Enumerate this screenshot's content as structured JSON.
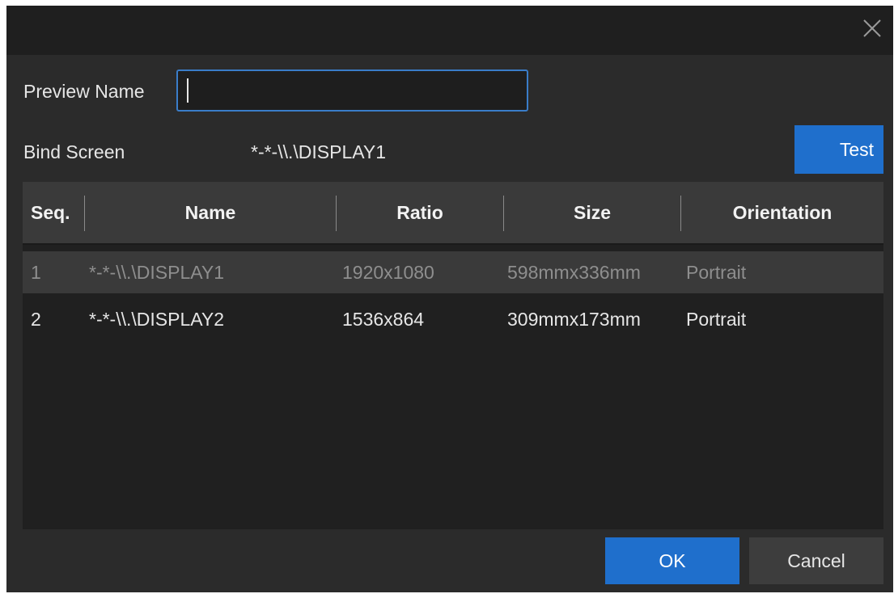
{
  "dialog": {
    "close_icon": "close-icon"
  },
  "form": {
    "preview_name_label": "Preview Name",
    "preview_name_value": "",
    "bind_screen_label": "Bind Screen",
    "bind_screen_value": "*-*-\\\\.\\DISPLAY1",
    "test_label": "Test"
  },
  "table": {
    "columns": [
      "Seq.",
      "Name",
      "Ratio",
      "Size",
      "Orientation"
    ],
    "rows": [
      {
        "seq": "1",
        "name": "*-*-\\\\.\\DISPLAY1",
        "ratio": "1920x1080",
        "size": "598mmx336mm",
        "orientation": "Portrait",
        "selected": true
      },
      {
        "seq": "2",
        "name": "*-*-\\\\.\\DISPLAY2",
        "ratio": "1536x864",
        "size": "309mmx173mm",
        "orientation": "Portrait",
        "selected": false
      }
    ]
  },
  "footer": {
    "ok_label": "OK",
    "cancel_label": "Cancel"
  },
  "colors": {
    "accent": "#1f6fcc",
    "background": "#2b2b2b",
    "titlebar": "#1f1f1f"
  }
}
